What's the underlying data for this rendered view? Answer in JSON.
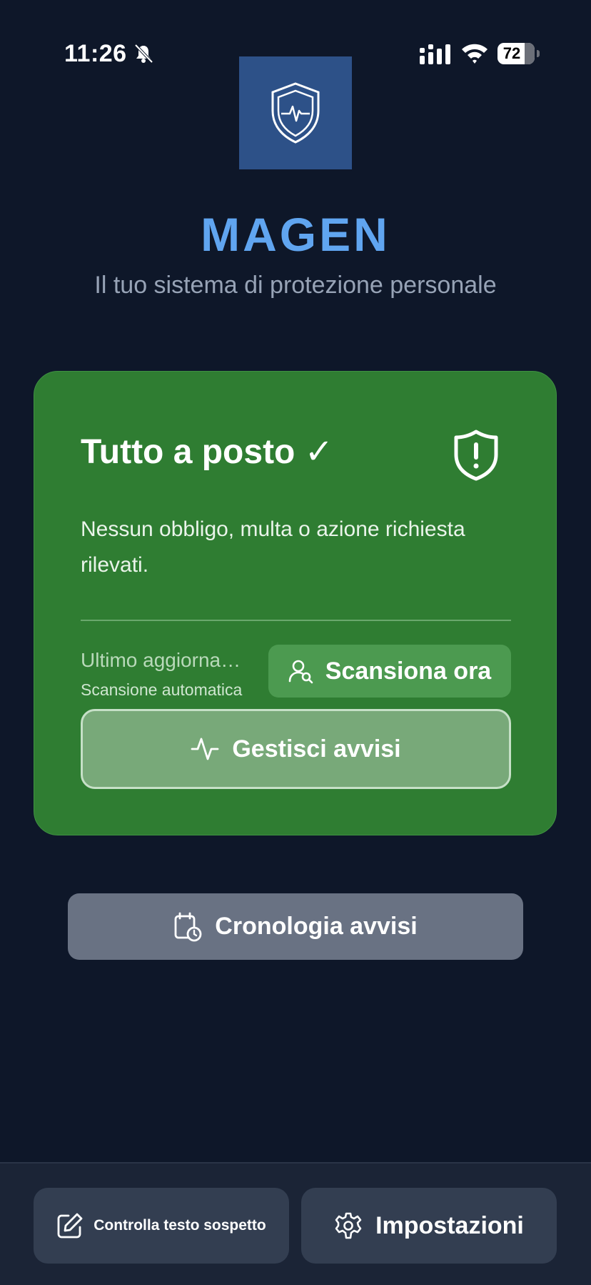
{
  "status_bar": {
    "time": "11:26",
    "battery_level": "72",
    "icons": [
      "bell-slash-icon",
      "signal-icon",
      "wifi-icon",
      "battery-icon"
    ]
  },
  "header": {
    "logo_icon": "shield-heartbeat-icon",
    "title": "MAGEN",
    "subtitle": "Il tuo sistema di protezione personale"
  },
  "status_card": {
    "title": "Tutto a posto ✓",
    "icon": "shield-alert-icon",
    "description": "Nessun obbligo, multa o azione richiesta rilevati.",
    "last_update": "Ultimo aggiornamento",
    "auto_scan": "Scansione automatica",
    "scan_label": "Scansiona ora",
    "manage_label": "Gestisci avvisi",
    "background_color": "#2f7d32"
  },
  "history": {
    "label": "Cronologia avvisi",
    "icon": "calendar-clock-icon"
  },
  "bottom_bar": {
    "check_text_label": "Controlla testo sospetto",
    "settings_label": "Impostazioni"
  },
  "colors": {
    "background": "#0e1729",
    "accent": "#60a5f0",
    "card": "#2f7d32"
  }
}
